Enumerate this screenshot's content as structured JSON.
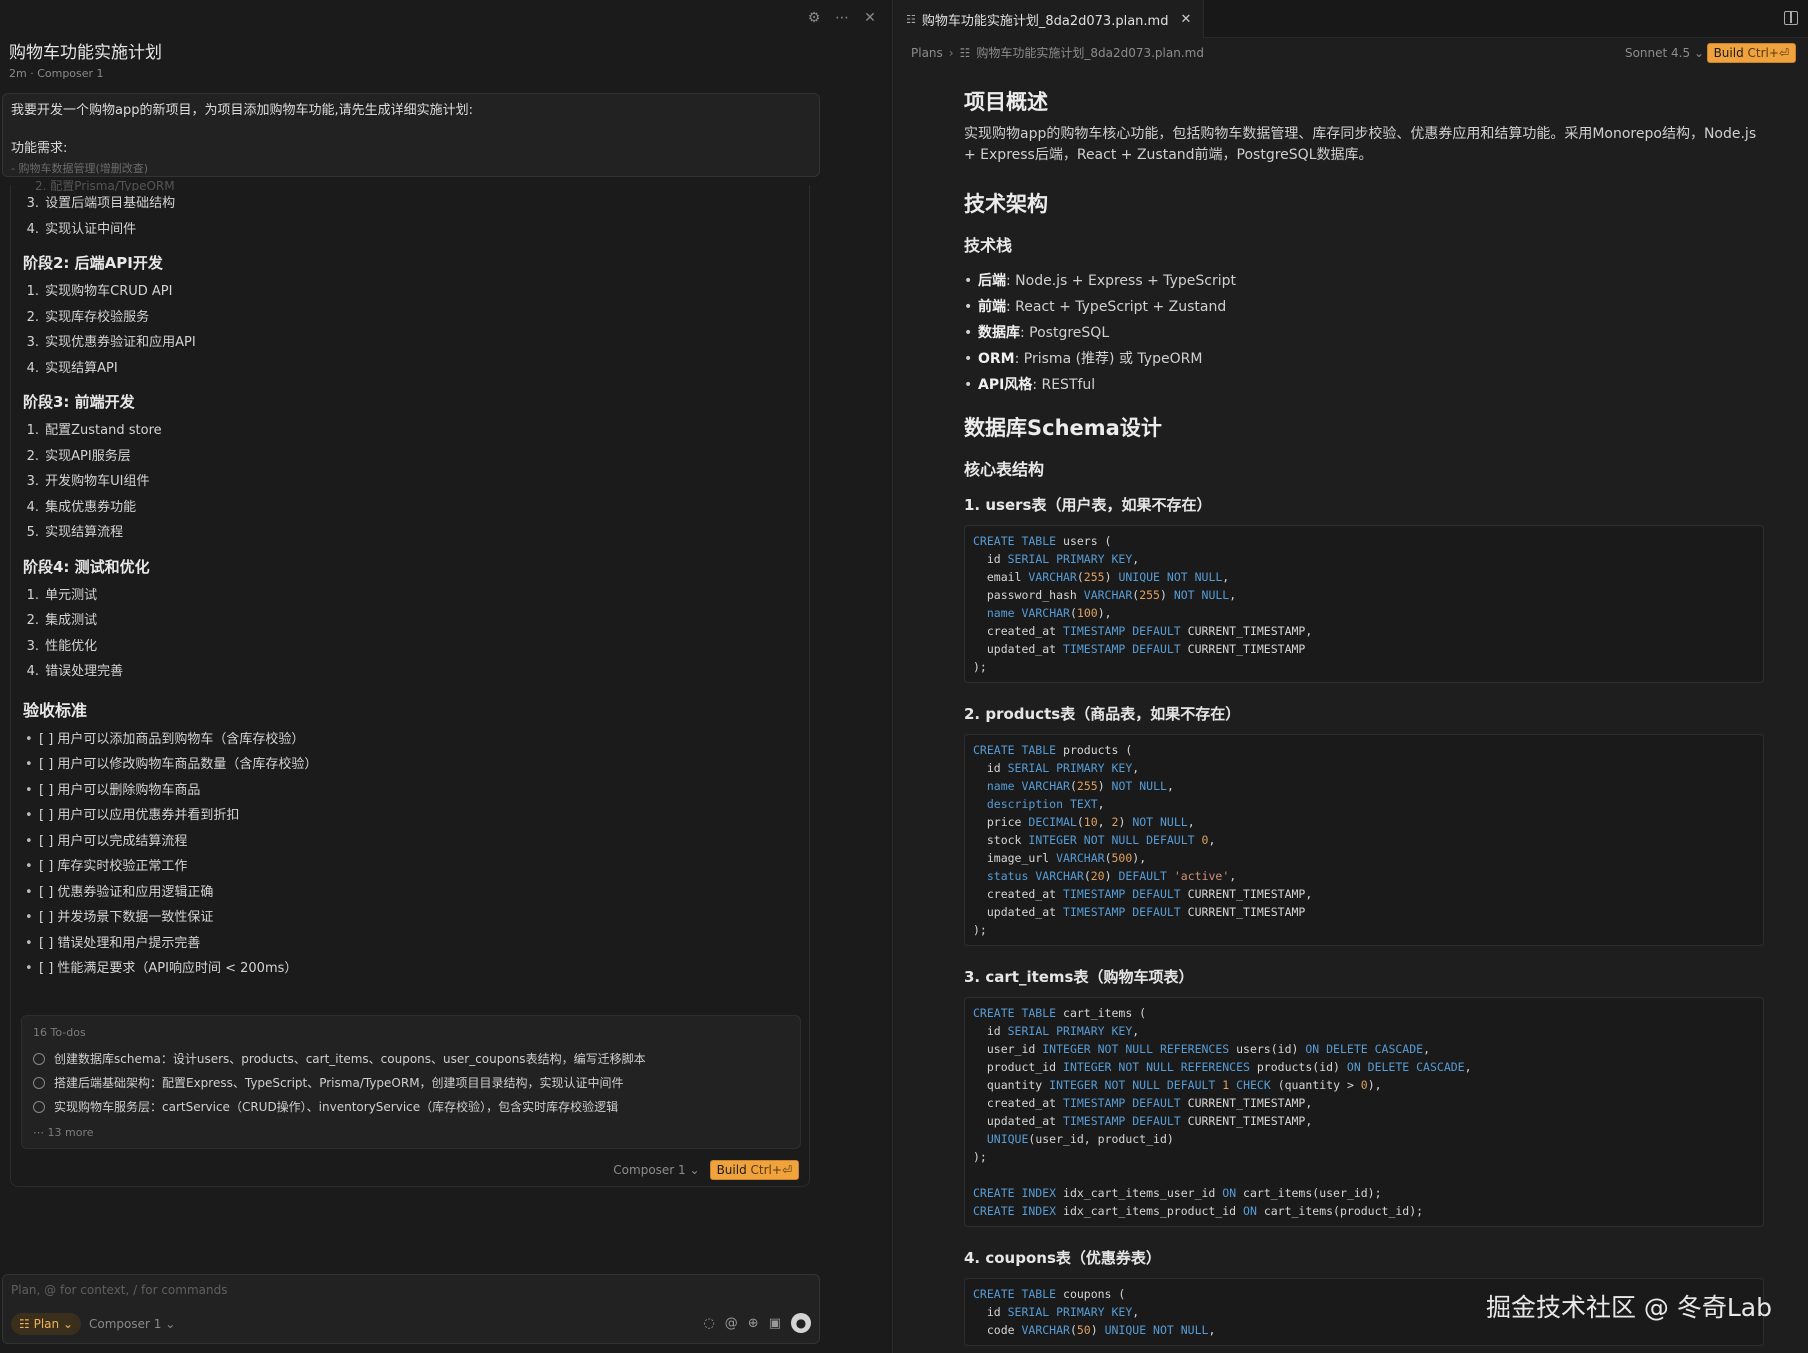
{
  "chat": {
    "title": "购物车功能实施计划",
    "meta": "2m · Composer 1",
    "user_message": {
      "line1": "我要开发一个购物app的新项目，为项目添加购物车功能,请先生成详细实施计划:",
      "line2": "功能需求:",
      "line3": "- 购物车数据管理(增删改查)"
    },
    "ghost_line": "2. 配置Prisma/TypeORM",
    "phase1_items": [
      {
        "n": "3.",
        "t": "设置后端项目基础结构"
      },
      {
        "n": "4.",
        "t": "实现认证中间件"
      }
    ],
    "phase2": {
      "title": "阶段2: 后端API开发",
      "items": [
        {
          "n": "1.",
          "t": "实现购物车CRUD API"
        },
        {
          "n": "2.",
          "t": "实现库存校验服务"
        },
        {
          "n": "3.",
          "t": "实现优惠券验证和应用API"
        },
        {
          "n": "4.",
          "t": "实现结算API"
        }
      ]
    },
    "phase3": {
      "title": "阶段3: 前端开发",
      "items": [
        {
          "n": "1.",
          "t": "配置Zustand store"
        },
        {
          "n": "2.",
          "t": "实现API服务层"
        },
        {
          "n": "3.",
          "t": "开发购物车UI组件"
        },
        {
          "n": "4.",
          "t": "集成优惠券功能"
        },
        {
          "n": "5.",
          "t": "实现结算流程"
        }
      ]
    },
    "phase4": {
      "title": "阶段4: 测试和优化",
      "items": [
        {
          "n": "1.",
          "t": "单元测试"
        },
        {
          "n": "2.",
          "t": "集成测试"
        },
        {
          "n": "3.",
          "t": "性能优化"
        },
        {
          "n": "4.",
          "t": "错误处理完善"
        }
      ]
    },
    "acceptance": {
      "title": "验收标准",
      "items": [
        "[ ] 用户可以添加商品到购物车（含库存校验）",
        "[ ] 用户可以修改购物车商品数量（含库存校验）",
        "[ ] 用户可以删除购物车商品",
        "[ ] 用户可以应用优惠券并看到折扣",
        "[ ] 用户可以完成结算流程",
        "[ ] 库存实时校验正常工作",
        "[ ] 优惠券验证和应用逻辑正确",
        "[ ] 并发场景下数据一致性保证",
        "[ ] 错误处理和用户提示完善",
        "[ ] 性能满足要求（API响应时间 < 200ms）"
      ]
    },
    "todos": {
      "header": "16 To-dos",
      "items": [
        "创建数据库schema：设计users、products、cart_items、coupons、user_coupons表结构，编写迁移脚本",
        "搭建后端基础架构：配置Express、TypeScript、Prisma/TypeORM，创建项目目录结构，实现认证中间件",
        "实现购物车服务层：cartService（CRUD操作）、inventoryService（库存校验），包含实时库存校验逻辑"
      ],
      "more": "13 more"
    },
    "footer": {
      "model": "Composer 1",
      "build": "Build",
      "build_key": "Ctrl+⏎"
    },
    "composer": {
      "placeholder": "Plan, @ for context, / for commands",
      "mode": "Plan",
      "model": "Composer 1"
    }
  },
  "editor": {
    "tab_label": "购物车功能实施计划_8da2d073.plan.md",
    "breadcrumb": [
      "Plans",
      "购物车功能实施计划_8da2d073.plan.md"
    ],
    "model": "Sonnet 4.5",
    "build": "Build",
    "build_key": "Ctrl+⏎",
    "doc": {
      "h_overview": "项目概述",
      "overview": "实现购物app的购物车核心功能，包括购物车数据管理、库存同步校验、优惠券应用和结算功能。采用Monorepo结构，Node.js + Express后端，React + Zustand前端，PostgreSQL数据库。",
      "h_arch": "技术架构",
      "h_stack": "技术栈",
      "stack": [
        {
          "k": "后端",
          "v": ": Node.js + Express + TypeScript"
        },
        {
          "k": "前端",
          "v": ": React + TypeScript + Zustand"
        },
        {
          "k": "数据库",
          "v": ": PostgreSQL"
        },
        {
          "k": "ORM",
          "v": ": Prisma (推荐) 或 TypeORM"
        },
        {
          "k": "API风格",
          "v": ": RESTful"
        }
      ],
      "h_schema": "数据库Schema设计",
      "h_core": "核心表结构",
      "t1": "1. users表（用户表，如果不存在）",
      "t2": "2. products表（商品表，如果不存在）",
      "t3": "3. cart_items表（购物车项表）",
      "t4": "4. coupons表（优惠券表）"
    }
  },
  "watermark": "掘金技术社区 @ 冬奇Lab"
}
